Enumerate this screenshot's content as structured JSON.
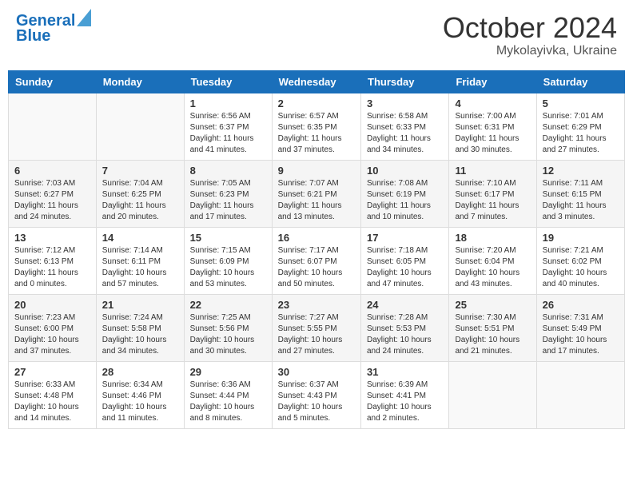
{
  "header": {
    "logo_line1": "General",
    "logo_line2": "Blue",
    "month_title": "October 2024",
    "location": "Mykolayivka, Ukraine"
  },
  "days_of_week": [
    "Sunday",
    "Monday",
    "Tuesday",
    "Wednesday",
    "Thursday",
    "Friday",
    "Saturday"
  ],
  "weeks": [
    [
      {
        "day": "",
        "info": ""
      },
      {
        "day": "",
        "info": ""
      },
      {
        "day": "1",
        "info": "Sunrise: 6:56 AM\nSunset: 6:37 PM\nDaylight: 11 hours and 41 minutes."
      },
      {
        "day": "2",
        "info": "Sunrise: 6:57 AM\nSunset: 6:35 PM\nDaylight: 11 hours and 37 minutes."
      },
      {
        "day": "3",
        "info": "Sunrise: 6:58 AM\nSunset: 6:33 PM\nDaylight: 11 hours and 34 minutes."
      },
      {
        "day": "4",
        "info": "Sunrise: 7:00 AM\nSunset: 6:31 PM\nDaylight: 11 hours and 30 minutes."
      },
      {
        "day": "5",
        "info": "Sunrise: 7:01 AM\nSunset: 6:29 PM\nDaylight: 11 hours and 27 minutes."
      }
    ],
    [
      {
        "day": "6",
        "info": "Sunrise: 7:03 AM\nSunset: 6:27 PM\nDaylight: 11 hours and 24 minutes."
      },
      {
        "day": "7",
        "info": "Sunrise: 7:04 AM\nSunset: 6:25 PM\nDaylight: 11 hours and 20 minutes."
      },
      {
        "day": "8",
        "info": "Sunrise: 7:05 AM\nSunset: 6:23 PM\nDaylight: 11 hours and 17 minutes."
      },
      {
        "day": "9",
        "info": "Sunrise: 7:07 AM\nSunset: 6:21 PM\nDaylight: 11 hours and 13 minutes."
      },
      {
        "day": "10",
        "info": "Sunrise: 7:08 AM\nSunset: 6:19 PM\nDaylight: 11 hours and 10 minutes."
      },
      {
        "day": "11",
        "info": "Sunrise: 7:10 AM\nSunset: 6:17 PM\nDaylight: 11 hours and 7 minutes."
      },
      {
        "day": "12",
        "info": "Sunrise: 7:11 AM\nSunset: 6:15 PM\nDaylight: 11 hours and 3 minutes."
      }
    ],
    [
      {
        "day": "13",
        "info": "Sunrise: 7:12 AM\nSunset: 6:13 PM\nDaylight: 11 hours and 0 minutes."
      },
      {
        "day": "14",
        "info": "Sunrise: 7:14 AM\nSunset: 6:11 PM\nDaylight: 10 hours and 57 minutes."
      },
      {
        "day": "15",
        "info": "Sunrise: 7:15 AM\nSunset: 6:09 PM\nDaylight: 10 hours and 53 minutes."
      },
      {
        "day": "16",
        "info": "Sunrise: 7:17 AM\nSunset: 6:07 PM\nDaylight: 10 hours and 50 minutes."
      },
      {
        "day": "17",
        "info": "Sunrise: 7:18 AM\nSunset: 6:05 PM\nDaylight: 10 hours and 47 minutes."
      },
      {
        "day": "18",
        "info": "Sunrise: 7:20 AM\nSunset: 6:04 PM\nDaylight: 10 hours and 43 minutes."
      },
      {
        "day": "19",
        "info": "Sunrise: 7:21 AM\nSunset: 6:02 PM\nDaylight: 10 hours and 40 minutes."
      }
    ],
    [
      {
        "day": "20",
        "info": "Sunrise: 7:23 AM\nSunset: 6:00 PM\nDaylight: 10 hours and 37 minutes."
      },
      {
        "day": "21",
        "info": "Sunrise: 7:24 AM\nSunset: 5:58 PM\nDaylight: 10 hours and 34 minutes."
      },
      {
        "day": "22",
        "info": "Sunrise: 7:25 AM\nSunset: 5:56 PM\nDaylight: 10 hours and 30 minutes."
      },
      {
        "day": "23",
        "info": "Sunrise: 7:27 AM\nSunset: 5:55 PM\nDaylight: 10 hours and 27 minutes."
      },
      {
        "day": "24",
        "info": "Sunrise: 7:28 AM\nSunset: 5:53 PM\nDaylight: 10 hours and 24 minutes."
      },
      {
        "day": "25",
        "info": "Sunrise: 7:30 AM\nSunset: 5:51 PM\nDaylight: 10 hours and 21 minutes."
      },
      {
        "day": "26",
        "info": "Sunrise: 7:31 AM\nSunset: 5:49 PM\nDaylight: 10 hours and 17 minutes."
      }
    ],
    [
      {
        "day": "27",
        "info": "Sunrise: 6:33 AM\nSunset: 4:48 PM\nDaylight: 10 hours and 14 minutes."
      },
      {
        "day": "28",
        "info": "Sunrise: 6:34 AM\nSunset: 4:46 PM\nDaylight: 10 hours and 11 minutes."
      },
      {
        "day": "29",
        "info": "Sunrise: 6:36 AM\nSunset: 4:44 PM\nDaylight: 10 hours and 8 minutes."
      },
      {
        "day": "30",
        "info": "Sunrise: 6:37 AM\nSunset: 4:43 PM\nDaylight: 10 hours and 5 minutes."
      },
      {
        "day": "31",
        "info": "Sunrise: 6:39 AM\nSunset: 4:41 PM\nDaylight: 10 hours and 2 minutes."
      },
      {
        "day": "",
        "info": ""
      },
      {
        "day": "",
        "info": ""
      }
    ]
  ]
}
